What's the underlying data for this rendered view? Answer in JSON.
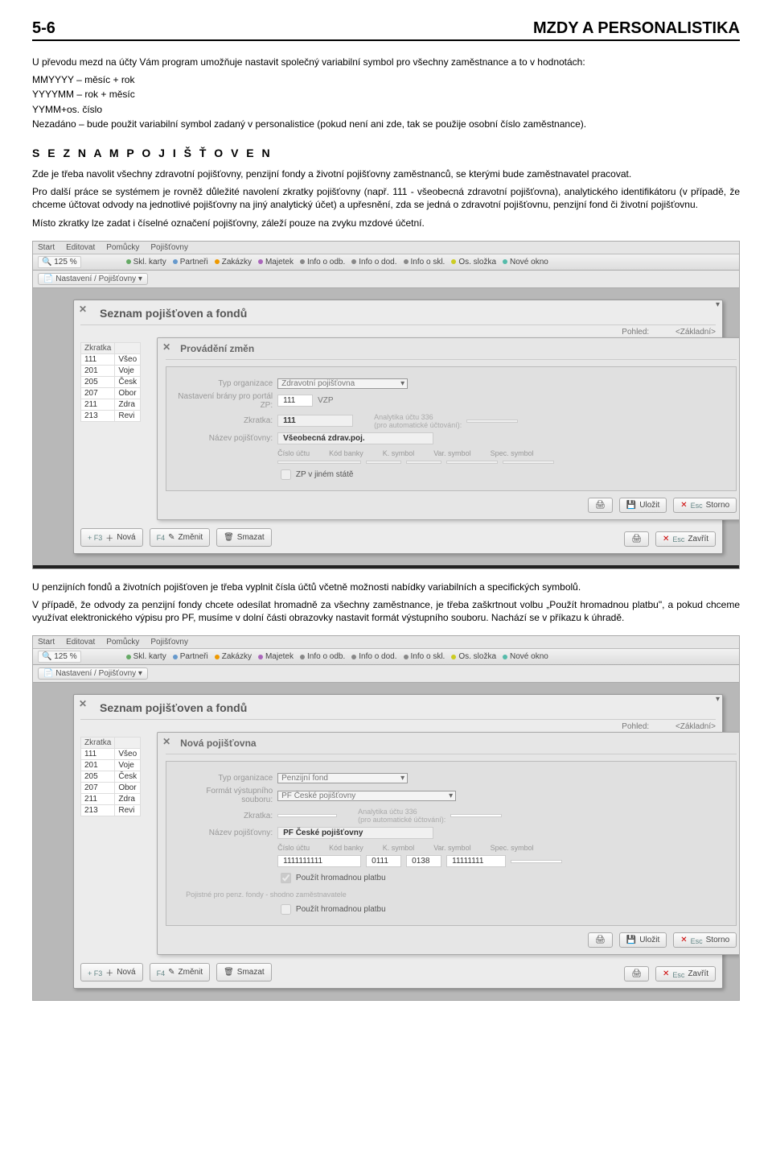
{
  "header": {
    "page_num": "5-6",
    "title": "MZDY A PERSONALISTIKA"
  },
  "intro_p1": "U převodu mezd na účty Vám program umožňuje nastavit společný variabilní symbol pro všechny zaměstnance a to v hodnotách:",
  "intro_list": [
    "MMYYYY – měsíc + rok",
    "YYYYMM – rok + měsíc",
    "YYMM+os. číslo",
    "Nezadáno – bude použit variabilní symbol zadaný v personalistice (pokud není ani zde, tak se použije osobní číslo zaměstnance)."
  ],
  "section_title": "S E Z N A M   P O J I Š Ť O V E N",
  "body_p1": "Zde je třeba navolit všechny zdravotní pojišťovny, penzijní fondy a životní pojišťovny zaměstnanců, se kterými bude zaměstnavatel pracovat.",
  "body_p2": "Pro další práce se systémem je rovněž důležité navolení zkratky pojišťovny (např. 111 - všeobecná zdravotní pojišťovna), analytického identifikátoru (v případě, že chceme účtovat odvody na jednotlivé pojišťovny na jiný analytický účet) a upřesnění, zda se jedná o zdravotní pojišťovnu, penzijní fond či životní pojišťovnu.",
  "body_p3": "Místo zkratky lze zadat i číselné označení pojišťovny, záleží pouze na zvyku mzdové účetní.",
  "below_p1": "U penzijních fondů a životních pojišťoven je třeba vyplnit čísla účtů včetně možnosti nabídky variabilních a specifických symbolů.",
  "below_p2": "V případě, že odvody za penzijní fondy chcete odesílat hromadně za všechny zaměstnance, je třeba zaškrtnout volbu „Použít hromadnou platbu\", a pokud chceme využívat elektronického výpisu pro PF, musíme v dolní části obrazovky nastavit formát výstupního souboru. Nachází se v příkazu k úhradě.",
  "app": {
    "menu": [
      "Start",
      "Editovat",
      "Pomůcky",
      "Pojišťovny"
    ],
    "zoom": "125 %",
    "toolbar_items": [
      "Skl. karty",
      "Partneři",
      "Zakázky",
      "Majetek",
      "Info o odb.",
      "Info o dod.",
      "Info o skl.",
      "Os. složka",
      "Nové okno"
    ],
    "tab": "Nastavení / Pojišťovny",
    "panel_title": "Seznam pojišťoven a fondů",
    "pohled_label": "Pohled:",
    "pohled_value": "<Základní>",
    "table_headers": [
      "Zkratka",
      ""
    ],
    "table_rows": [
      [
        "111",
        "Všeo"
      ],
      [
        "201",
        "Voje"
      ],
      [
        "205",
        "Česk"
      ],
      [
        "207",
        "Obor"
      ],
      [
        "211",
        "Zdra"
      ],
      [
        "213",
        "Revi"
      ]
    ],
    "btns": {
      "nova": "Nová",
      "nova_key": "+ F3",
      "zmenit": "Změnit",
      "zmenit_key": "F4",
      "smazat": "Smazat",
      "ulozit": "Uložit",
      "storno": "Storno",
      "storno_key": "Esc",
      "zavrit": "Zavřít",
      "zavrit_key": "Esc"
    },
    "col_headers": [
      "Číslo účtu",
      "Kód banky",
      "K. symbol",
      "Var. symbol",
      "Spec. symbol"
    ]
  },
  "shot1": {
    "ip_title": "Provádění změn",
    "typ_org_label": "Typ organizace",
    "typ_org_value": "Zdravotní pojišťovna",
    "portal_label": "Nastavení brány pro portál ZP:",
    "portal_code": "111",
    "portal_name": "VZP",
    "analytika_label": "Analytika účtu 336",
    "analytika_sub": "(pro automatické účtování):",
    "zkratka_label": "Zkratka:",
    "zkratka_value": "111",
    "nazev_label": "Název pojišťovny:",
    "nazev_value": "Všeobecná zdrav.poj.",
    "zp_jinem": "ZP v jiném státě"
  },
  "shot2": {
    "ip_title": "Nová pojišťovna",
    "typ_org_label": "Typ organizace",
    "typ_org_value": "Penzijní fond",
    "format_label": "Formát výstupního souboru:",
    "format_value": "PF České pojišťovny",
    "analytika_label": "Analytika účtu 336",
    "analytika_sub": "(pro automatické účtování):",
    "zkratka_label": "Zkratka:",
    "nazev_label": "Název pojišťovny:",
    "nazev_value": "PF České pojišťovny",
    "cislo_uctu": "1111111111",
    "kod_banky": "0111",
    "k_symbol": "0138",
    "var_symbol": "11111111",
    "chk1": "Použít hromadnou platbu",
    "pojsc": "Pojistné pro penz. fondy - shodno zaměstnavatele",
    "chk2": "Použít hromadnou platbu"
  }
}
